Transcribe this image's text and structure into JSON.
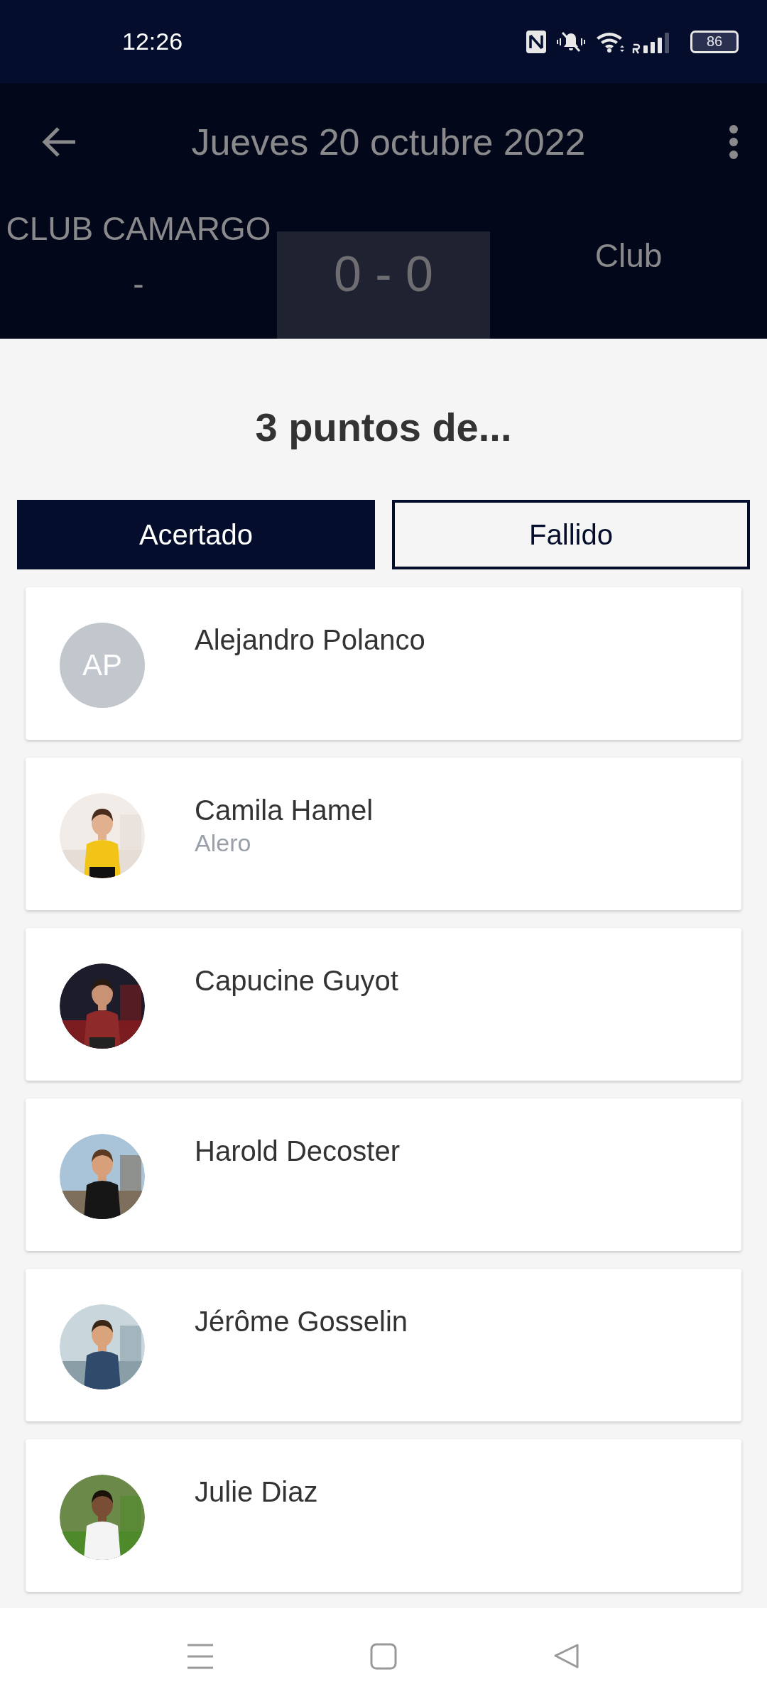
{
  "status_bar": {
    "time": "12:26",
    "battery": "86"
  },
  "header": {
    "title": "Jueves 20 octubre 2022",
    "home_team": "CLUB CAMARGO -",
    "score": "0 - 0",
    "away_team": "Club"
  },
  "sheet": {
    "title": "3 puntos de...",
    "tabs": [
      {
        "label": "Acertado",
        "selected": true
      },
      {
        "label": "Fallido",
        "selected": false
      }
    ],
    "players": [
      {
        "name": "Alejandro Polanco",
        "avatar": {
          "kind": "initials",
          "initials": "AP"
        }
      },
      {
        "name": "Camila Hamel",
        "position": "Alero"
      },
      {
        "name": "Capucine Guyot"
      },
      {
        "name": "Harold Decoster"
      },
      {
        "name": "Jérôme Gosselin"
      },
      {
        "name": "Julie Diaz"
      }
    ]
  }
}
